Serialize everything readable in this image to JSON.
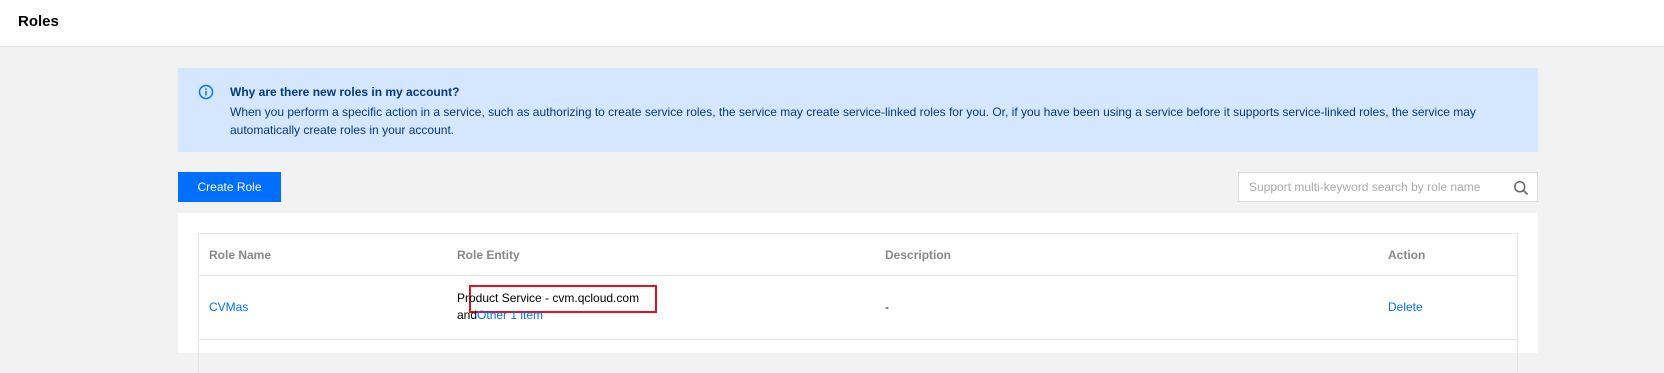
{
  "header": {
    "title": "Roles"
  },
  "notice": {
    "icon": "info-icon",
    "title": "Why are there new roles in my account?",
    "body": "When you perform a specific action in a service, such as authorizing to create service roles, the service may create service-linked roles for you. Or, if you have been using a service before it supports service-linked roles, the service may automatically create roles in your account."
  },
  "toolbar": {
    "create_label": "Create Role",
    "search_placeholder": "Support multi-keyword search by role name",
    "search_icon": "search-icon"
  },
  "table": {
    "columns": [
      "Role Name",
      "Role Entity",
      "Description",
      "Action"
    ],
    "rows": [
      {
        "role_name": "CVMas",
        "entity_primary": "Product Service - cvm.qcloud.com",
        "entity_prefix": "and",
        "entity_more": "Other 1 item",
        "description": "-",
        "action": "Delete"
      }
    ]
  },
  "colors": {
    "accent": "#006eff",
    "notice_bg": "#d5e7ff",
    "notice_text": "#003b80",
    "highlight": "#e1141e"
  }
}
